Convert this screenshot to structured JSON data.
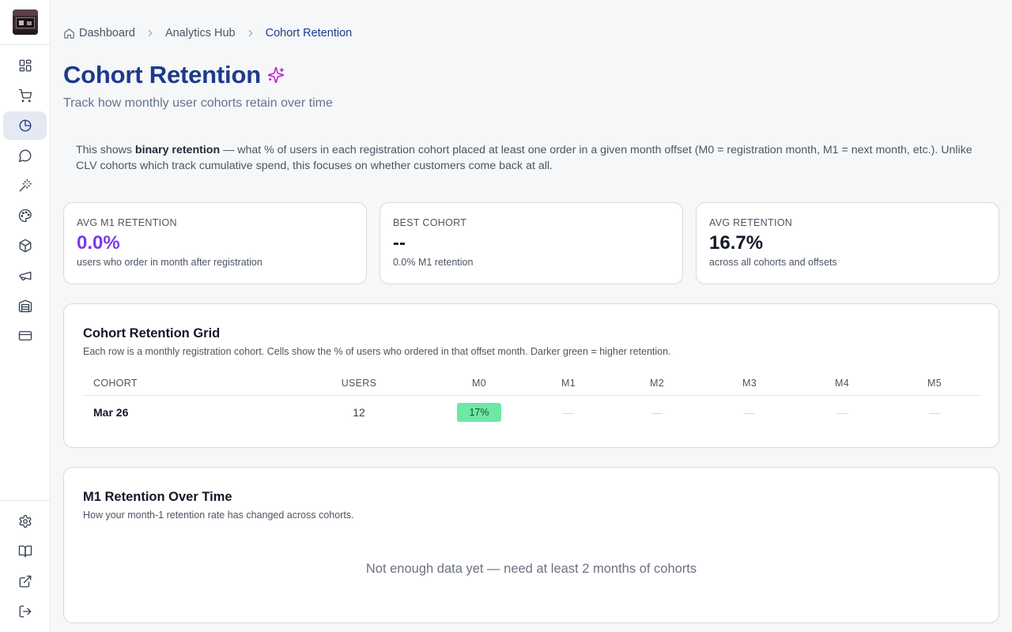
{
  "sidebar": {
    "nav": [
      {
        "name": "dashboard",
        "icon": "layout-grid-icon",
        "active": false
      },
      {
        "name": "orders",
        "icon": "shopping-cart-icon",
        "active": false
      },
      {
        "name": "analytics",
        "icon": "pie-chart-icon",
        "active": true
      },
      {
        "name": "messages",
        "icon": "message-circle-icon",
        "active": false
      },
      {
        "name": "ai-tools",
        "icon": "magic-wand-icon",
        "active": false
      },
      {
        "name": "themes",
        "icon": "palette-icon",
        "active": false
      },
      {
        "name": "products",
        "icon": "package-icon",
        "active": false
      },
      {
        "name": "marketing",
        "icon": "megaphone-icon",
        "active": false
      },
      {
        "name": "warehouse",
        "icon": "warehouse-icon",
        "active": false
      },
      {
        "name": "billing",
        "icon": "credit-card-icon",
        "active": false
      }
    ],
    "bottom": [
      {
        "name": "settings",
        "icon": "gear-icon"
      },
      {
        "name": "docs",
        "icon": "book-open-icon"
      },
      {
        "name": "external",
        "icon": "external-link-icon"
      },
      {
        "name": "logout",
        "icon": "log-out-icon"
      }
    ]
  },
  "breadcrumb": {
    "items": [
      "Dashboard",
      "Analytics Hub",
      "Cohort Retention"
    ]
  },
  "header": {
    "title": "Cohort Retention",
    "subtitle": "Track how monthly user cohorts retain over time"
  },
  "info": {
    "prefix": "This shows ",
    "bold": "binary retention",
    "rest": " — what % of users in each registration cohort placed at least one order in a given month offset (M0 = registration month, M1 = next month, etc.). Unlike CLV cohorts which track cumulative spend, this focuses on whether customers come back at all."
  },
  "stats": [
    {
      "label": "AVG M1 RETENTION",
      "value": "0.0%",
      "sub": "users who order in month after registration",
      "accent": "#7c3aed"
    },
    {
      "label": "BEST COHORT",
      "value": "--",
      "sub": "0.0% M1 retention"
    },
    {
      "label": "AVG RETENTION",
      "value": "16.7%",
      "sub": "across all cohorts and offsets"
    }
  ],
  "grid": {
    "title": "Cohort Retention Grid",
    "description": "Each row is a monthly registration cohort. Cells show the % of users who ordered in that offset month. Darker green = higher retention.",
    "columns": [
      "COHORT",
      "USERS",
      "M0",
      "M1",
      "M2",
      "M3",
      "M4",
      "M5"
    ],
    "rows": [
      {
        "cohort": "Mar 26",
        "users": "12",
        "cells": [
          "17%",
          "—",
          "—",
          "—",
          "—",
          "—"
        ]
      }
    ],
    "cell_color": "#6ee7a4"
  },
  "m1_chart": {
    "title": "M1 Retention Over Time",
    "description": "How your month-1 retention rate has changed across cohorts.",
    "empty_message": "Not enough data yet — need at least 2 months of cohorts"
  }
}
